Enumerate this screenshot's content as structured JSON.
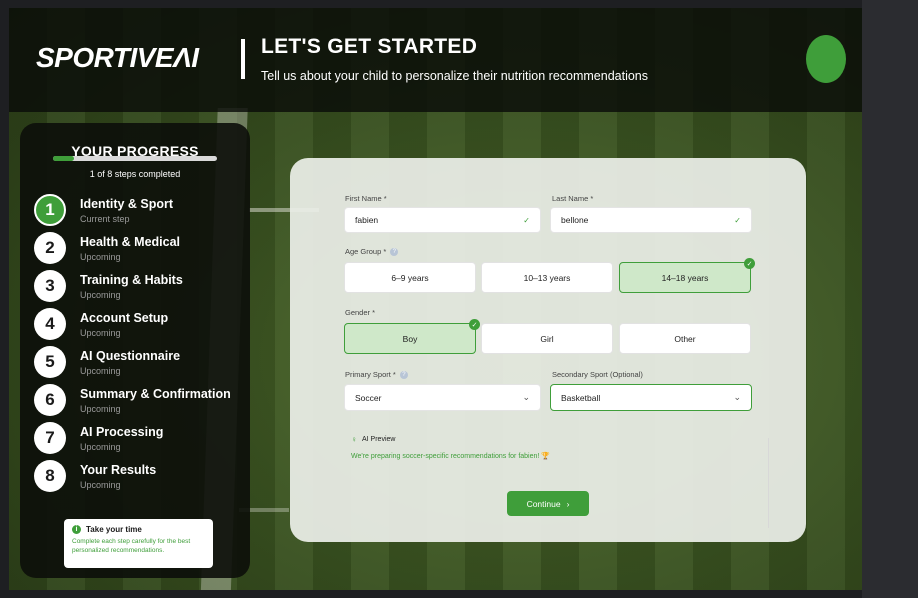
{
  "header": {
    "logo_main": "SPORTIVE",
    "logo_ai": "ΛI",
    "title": "LET'S GET STARTED",
    "subtitle": "Tell us about your child to personalize their nutrition recommendations"
  },
  "progress": {
    "title": "YOUR PROGRESS",
    "fraction_complete": 0.125,
    "count_text": "1 of 8 steps completed",
    "steps": [
      {
        "num": "1",
        "label": "Identity & Sport",
        "status": "Current step",
        "active": true
      },
      {
        "num": "2",
        "label": "Health & Medical",
        "status": "Upcoming"
      },
      {
        "num": "3",
        "label": "Training & Habits",
        "status": "Upcoming"
      },
      {
        "num": "4",
        "label": "Account Setup",
        "status": "Upcoming"
      },
      {
        "num": "5",
        "label": "AI Questionnaire",
        "status": "Upcoming"
      },
      {
        "num": "6",
        "label": "Summary & Confirmation",
        "status": "Upcoming"
      },
      {
        "num": "7",
        "label": "AI Processing",
        "status": "Upcoming"
      },
      {
        "num": "8",
        "label": "Your Results",
        "status": "Upcoming"
      }
    ],
    "tip": {
      "title": "Take your time",
      "body": "Complete each step carefully for the best personalized recommendations."
    }
  },
  "form": {
    "first_name": {
      "label": "First Name *",
      "value": "fabien"
    },
    "last_name": {
      "label": "Last Name *",
      "value": "bellone"
    },
    "age_group": {
      "label": "Age Group *",
      "options": [
        "6–9 years",
        "10–13 years",
        "14–18 years"
      ],
      "selected": "14–18 years"
    },
    "gender": {
      "label": "Gender *",
      "options": [
        "Boy",
        "Girl",
        "Other"
      ],
      "selected": "Boy"
    },
    "primary_sport": {
      "label": "Primary Sport *",
      "value": "Soccer"
    },
    "secondary_sport": {
      "label": "Secondary Sport (Optional)",
      "value": "Basketball"
    },
    "preview": {
      "title": "AI Preview",
      "text": "We're preparing soccer-specific recommendations for fabien! 🏆"
    },
    "continue_label": "Continue"
  },
  "colors": {
    "accent": "#3f9e3a",
    "selected_bg": "#cfe8c9"
  },
  "icons": {
    "help": "question-icon",
    "check": "check-icon",
    "chevron": "chevron-down-icon",
    "bulb": "bulb-icon",
    "info": "info-icon"
  }
}
